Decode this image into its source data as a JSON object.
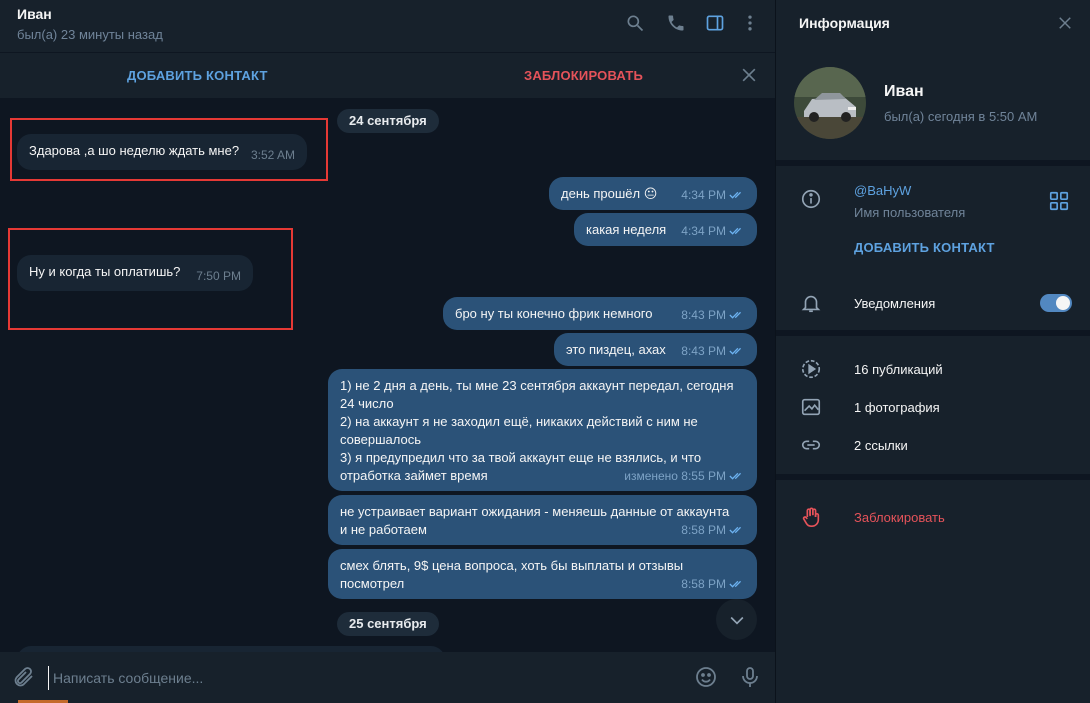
{
  "chat": {
    "name": "Иван",
    "status": "был(а) 23 минуты назад",
    "action_bar": {
      "add_contact": "ДОБАВИТЬ КОНТАКТ",
      "block": "ЗАБЛОКИРОВАТЬ"
    },
    "dates": [
      "24 сентября",
      "25 сентября"
    ],
    "messages": [
      {
        "dir": "in",
        "text": "Здарова ,а шо неделю ждать мне?",
        "time": "3:52 AM"
      },
      {
        "dir": "out",
        "text": "день прошёл 😐",
        "time": "4:34 PM"
      },
      {
        "dir": "out",
        "text": "какая неделя",
        "time": "4:34 PM"
      },
      {
        "dir": "in",
        "text": "Ну и когда ты оплатишь?",
        "time": "7:50 PM"
      },
      {
        "dir": "out",
        "text": "бро ну ты конечно фрик немного",
        "time": "8:43 PM"
      },
      {
        "dir": "out",
        "text": "это пиздец, ахах",
        "time": "8:43 PM"
      },
      {
        "dir": "out",
        "lines": [
          "1) не 2 дня а день, ты мне 23 сентября аккаунт передал, сегодня",
          "24 число",
          "2) на аккаунт я не заходил ещё, никаких действий с ним не",
          "совершалось",
          "3) я предупредил что за твой аккаунт еще не взялись, и что",
          "отработка займет время"
        ],
        "time": "изменено 8:55 PM"
      },
      {
        "dir": "out",
        "lines": [
          "не устраивает вариант ожидания - меняешь данные от аккаунта",
          "и не работаем"
        ],
        "time": "8:58 PM"
      },
      {
        "dir": "out",
        "lines": [
          "смех блять, 9$ цена вопроса, хоть бы выплаты и отзывы",
          "посмотрел"
        ],
        "time": "8:58 PM"
      }
    ],
    "composer_placeholder": "Написать сообщение..."
  },
  "info": {
    "title": "Информация",
    "name": "Иван",
    "status": "был(а) сегодня в 5:50 AM",
    "username": "@BaHyW",
    "username_label": "Имя пользователя",
    "add_contact": "ДОБАВИТЬ КОНТАКТ",
    "notifications": "Уведомления",
    "notifications_on": true,
    "posts": "16 публикаций",
    "photos": "1 фотография",
    "links": "2 ссылки",
    "block": "Заблокировать"
  },
  "colors": {
    "accent": "#5ea2e0",
    "danger": "#e5535a",
    "bubble_out": "#2b5278",
    "bubble_in": "#182533",
    "panel": "#17212b",
    "bg": "#0e1621",
    "highlight_box": "#e53935"
  }
}
